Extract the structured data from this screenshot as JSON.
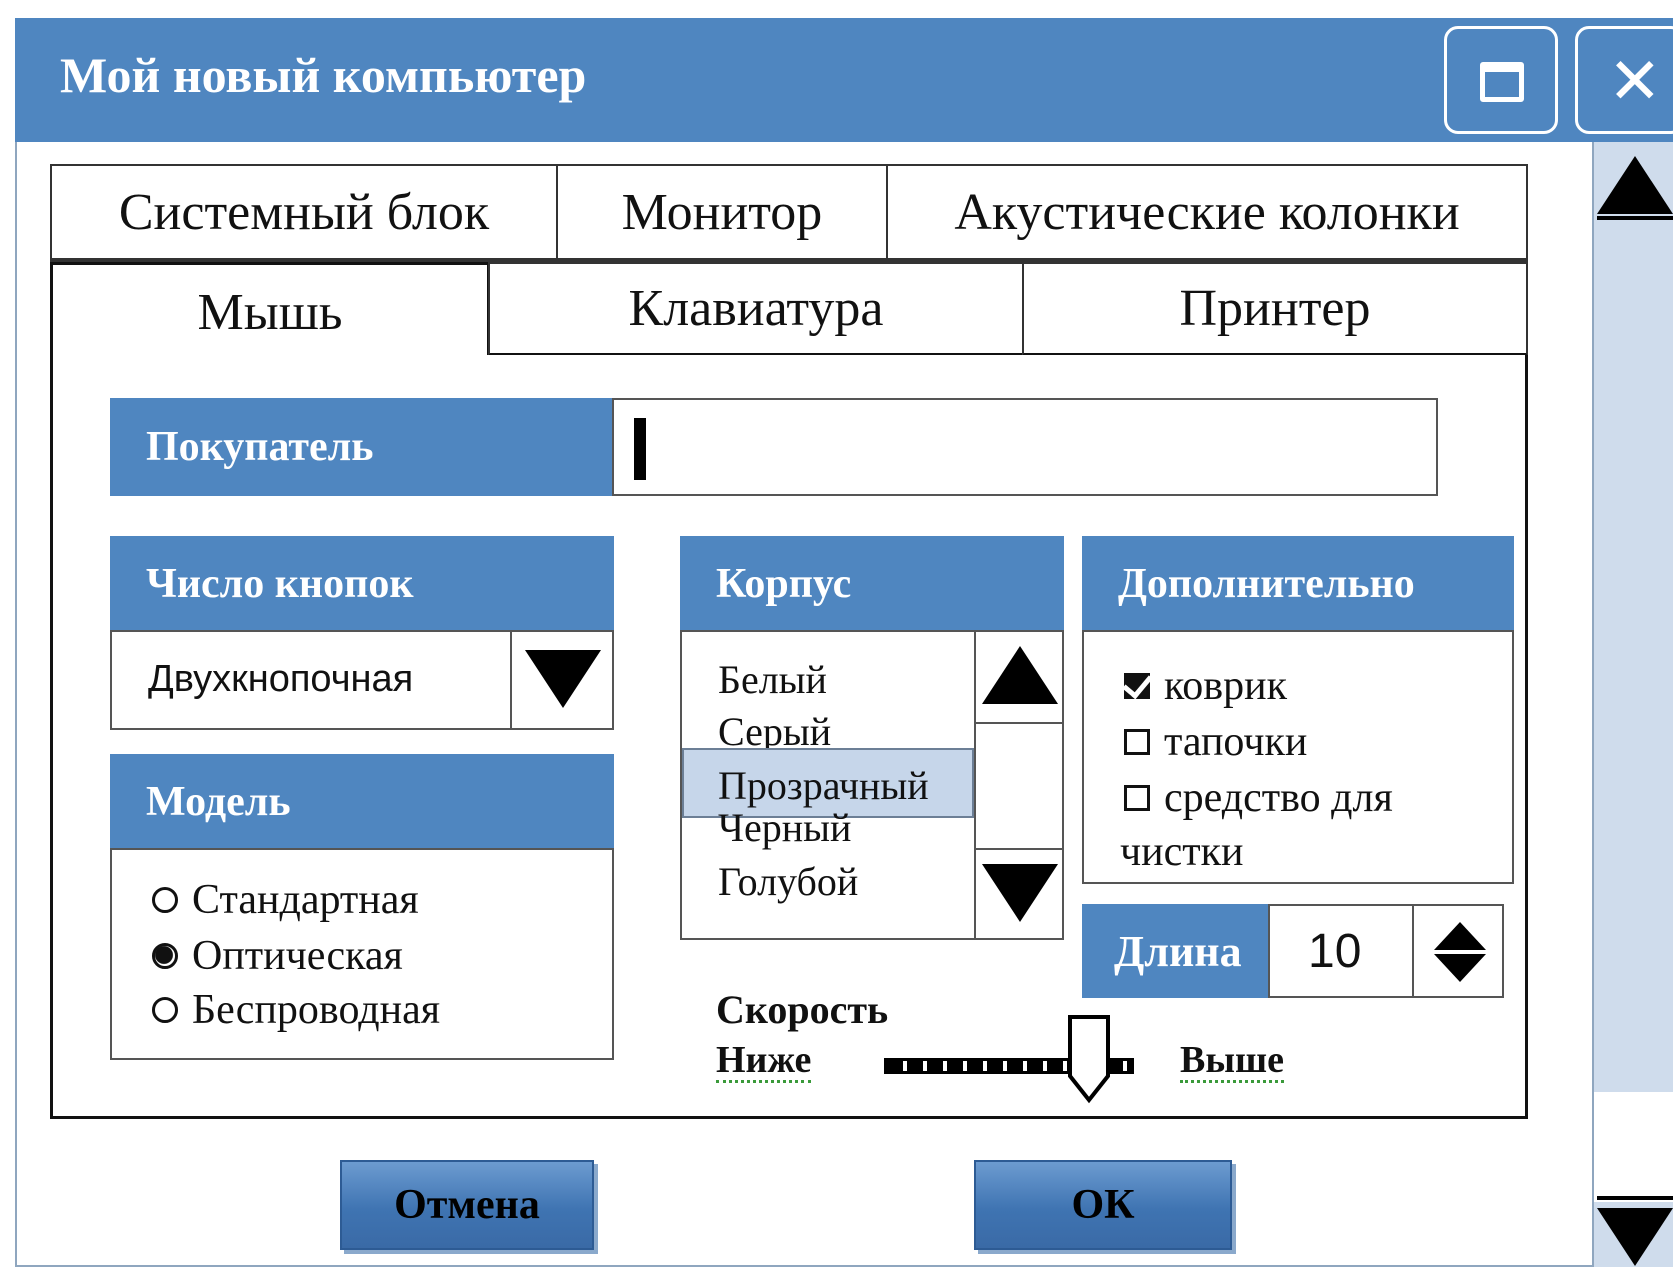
{
  "window": {
    "title": "Мой новый компьютер",
    "accent": "#4f86c0"
  },
  "tabs": {
    "row1": [
      "Системный блок",
      "Монитор",
      "Акустические колонки"
    ],
    "row2": [
      "Мышь",
      "Клавиатура",
      "Принтер"
    ],
    "active": "Мышь"
  },
  "form": {
    "buyer": {
      "label": "Покупатель",
      "value": ""
    },
    "buttons_count": {
      "label": "Число кнопок",
      "selected": "Двухкнопочная"
    },
    "model": {
      "label": "Модель",
      "options": [
        "Стандартная",
        "Оптическая",
        "Беспроводная"
      ],
      "selected": "Оптическая"
    },
    "case": {
      "label": "Корпус",
      "items": [
        "Белый",
        "Серый",
        "Прозрачный",
        "Черный",
        "Голубой"
      ],
      "selected": "Прозрачный"
    },
    "extra": {
      "label": "Дополнительно",
      "options": [
        {
          "label": "коврик",
          "checked": true
        },
        {
          "label": "тапочки",
          "checked": false
        },
        {
          "label": "средство для",
          "checked": false
        }
      ],
      "continuation": "чистки"
    },
    "length": {
      "label": "Длина",
      "value": "10"
    },
    "speed": {
      "label": "Скорость",
      "low": "Ниже",
      "high": "Выше",
      "level": 0.82
    }
  },
  "actions": {
    "cancel": "Отмена",
    "ok": "ОК"
  },
  "icons": {
    "maximize": "maximize-icon",
    "close": "close-icon",
    "scroll_up": "arrow-up-icon",
    "scroll_down": "arrow-down-icon"
  }
}
